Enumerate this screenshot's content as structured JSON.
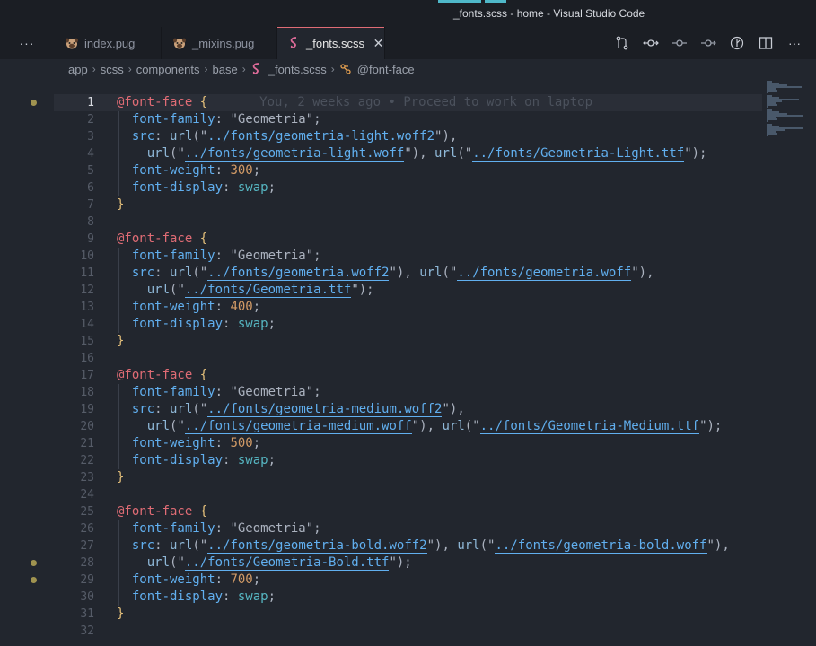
{
  "window": {
    "title": "_fonts.scss - home - Visual Studio Code"
  },
  "tabs": [
    {
      "label": "index.pug",
      "icon": "pug-icon",
      "active": false
    },
    {
      "label": "_mixins.pug",
      "icon": "pug-icon",
      "active": false
    },
    {
      "label": "_fonts.scss",
      "icon": "sass-icon",
      "active": true
    }
  ],
  "tab_more": "···",
  "tab_close": "✕",
  "actions": [
    {
      "name": "source-control-icon",
      "glyph": "⇅"
    },
    {
      "name": "git-compare-icon",
      "glyph": "↔"
    },
    {
      "name": "git-commit-icon",
      "glyph": "⊸"
    },
    {
      "name": "git-next-icon",
      "glyph": "→"
    },
    {
      "name": "git-graph-icon",
      "glyph": "⚲"
    },
    {
      "name": "split-editor-icon",
      "glyph": "◫"
    },
    {
      "name": "more-actions-icon",
      "glyph": "···"
    }
  ],
  "breadcrumb": [
    "app",
    "scss",
    "components",
    "base",
    "_fonts.scss",
    "@font-face"
  ],
  "blame": "You, 2 weeks ago • Proceed to work on laptop",
  "lines": [
    {
      "n": "1",
      "t": [
        [
          "at",
          "@font-face"
        ],
        [
          "pun",
          " "
        ],
        [
          "br",
          "{"
        ]
      ]
    },
    {
      "n": "2",
      "t": [
        [
          "pun",
          "  "
        ],
        [
          "prop",
          "font-family"
        ],
        [
          "pun",
          ": "
        ],
        [
          "strq",
          "\"Geometria\""
        ],
        [
          "pun",
          ";"
        ]
      ]
    },
    {
      "n": "3",
      "t": [
        [
          "pun",
          "  "
        ],
        [
          "prop",
          "src"
        ],
        [
          "pun",
          ": "
        ],
        [
          "fn",
          "url"
        ],
        [
          "pun",
          "(\""
        ],
        [
          "url",
          "../fonts/geometria-light.woff2"
        ],
        [
          "pun",
          "\"),"
        ]
      ]
    },
    {
      "n": "4",
      "t": [
        [
          "pun",
          "    "
        ],
        [
          "fn",
          "url"
        ],
        [
          "pun",
          "(\""
        ],
        [
          "url",
          "../fonts/geometria-light.woff"
        ],
        [
          "pun",
          "\"), "
        ],
        [
          "fn",
          "url"
        ],
        [
          "pun",
          "(\""
        ],
        [
          "url",
          "../fonts/Geometria-Light.ttf"
        ],
        [
          "pun",
          "\");"
        ]
      ]
    },
    {
      "n": "5",
      "t": [
        [
          "pun",
          "  "
        ],
        [
          "prop",
          "font-weight"
        ],
        [
          "pun",
          ": "
        ],
        [
          "num",
          "300"
        ],
        [
          "pun",
          ";"
        ]
      ]
    },
    {
      "n": "6",
      "t": [
        [
          "pun",
          "  "
        ],
        [
          "prop",
          "font-display"
        ],
        [
          "pun",
          ": "
        ],
        [
          "val",
          "swap"
        ],
        [
          "pun",
          ";"
        ]
      ]
    },
    {
      "n": "7",
      "t": [
        [
          "br",
          "}"
        ]
      ]
    },
    {
      "n": "8",
      "t": []
    },
    {
      "n": "9",
      "t": [
        [
          "at",
          "@font-face"
        ],
        [
          "pun",
          " "
        ],
        [
          "br",
          "{"
        ]
      ]
    },
    {
      "n": "10",
      "t": [
        [
          "pun",
          "  "
        ],
        [
          "prop",
          "font-family"
        ],
        [
          "pun",
          ": "
        ],
        [
          "strq",
          "\"Geometria\""
        ],
        [
          "pun",
          ";"
        ]
      ]
    },
    {
      "n": "11",
      "t": [
        [
          "pun",
          "  "
        ],
        [
          "prop",
          "src"
        ],
        [
          "pun",
          ": "
        ],
        [
          "fn",
          "url"
        ],
        [
          "pun",
          "(\""
        ],
        [
          "url",
          "../fonts/geometria.woff2"
        ],
        [
          "pun",
          "\"), "
        ],
        [
          "fn",
          "url"
        ],
        [
          "pun",
          "(\""
        ],
        [
          "url",
          "../fonts/geometria.woff"
        ],
        [
          "pun",
          "\"),"
        ]
      ]
    },
    {
      "n": "12",
      "t": [
        [
          "pun",
          "    "
        ],
        [
          "fn",
          "url"
        ],
        [
          "pun",
          "(\""
        ],
        [
          "url",
          "../fonts/Geometria.ttf"
        ],
        [
          "pun",
          "\");"
        ]
      ]
    },
    {
      "n": "13",
      "t": [
        [
          "pun",
          "  "
        ],
        [
          "prop",
          "font-weight"
        ],
        [
          "pun",
          ": "
        ],
        [
          "num",
          "400"
        ],
        [
          "pun",
          ";"
        ]
      ]
    },
    {
      "n": "14",
      "t": [
        [
          "pun",
          "  "
        ],
        [
          "prop",
          "font-display"
        ],
        [
          "pun",
          ": "
        ],
        [
          "val",
          "swap"
        ],
        [
          "pun",
          ";"
        ]
      ]
    },
    {
      "n": "15",
      "t": [
        [
          "br",
          "}"
        ]
      ]
    },
    {
      "n": "16",
      "t": []
    },
    {
      "n": "17",
      "t": [
        [
          "at",
          "@font-face"
        ],
        [
          "pun",
          " "
        ],
        [
          "br",
          "{"
        ]
      ]
    },
    {
      "n": "18",
      "t": [
        [
          "pun",
          "  "
        ],
        [
          "prop",
          "font-family"
        ],
        [
          "pun",
          ": "
        ],
        [
          "strq",
          "\"Geometria\""
        ],
        [
          "pun",
          ";"
        ]
      ]
    },
    {
      "n": "19",
      "t": [
        [
          "pun",
          "  "
        ],
        [
          "prop",
          "src"
        ],
        [
          "pun",
          ": "
        ],
        [
          "fn",
          "url"
        ],
        [
          "pun",
          "(\""
        ],
        [
          "url",
          "../fonts/geometria-medium.woff2"
        ],
        [
          "pun",
          "\"),"
        ]
      ]
    },
    {
      "n": "20",
      "t": [
        [
          "pun",
          "    "
        ],
        [
          "fn",
          "url"
        ],
        [
          "pun",
          "(\""
        ],
        [
          "url",
          "../fonts/geometria-medium.woff"
        ],
        [
          "pun",
          "\"), "
        ],
        [
          "fn",
          "url"
        ],
        [
          "pun",
          "(\""
        ],
        [
          "url",
          "../fonts/Geometria-Medium.ttf"
        ],
        [
          "pun",
          "\");"
        ]
      ]
    },
    {
      "n": "21",
      "t": [
        [
          "pun",
          "  "
        ],
        [
          "prop",
          "font-weight"
        ],
        [
          "pun",
          ": "
        ],
        [
          "num",
          "500"
        ],
        [
          "pun",
          ";"
        ]
      ]
    },
    {
      "n": "22",
      "t": [
        [
          "pun",
          "  "
        ],
        [
          "prop",
          "font-display"
        ],
        [
          "pun",
          ": "
        ],
        [
          "val",
          "swap"
        ],
        [
          "pun",
          ";"
        ]
      ]
    },
    {
      "n": "23",
      "t": [
        [
          "br",
          "}"
        ]
      ]
    },
    {
      "n": "24",
      "t": []
    },
    {
      "n": "25",
      "t": [
        [
          "at",
          "@font-face"
        ],
        [
          "pun",
          " "
        ],
        [
          "br",
          "{"
        ]
      ]
    },
    {
      "n": "26",
      "t": [
        [
          "pun",
          "  "
        ],
        [
          "prop",
          "font-family"
        ],
        [
          "pun",
          ": "
        ],
        [
          "strq",
          "\"Geometria\""
        ],
        [
          "pun",
          ";"
        ]
      ]
    },
    {
      "n": "27",
      "t": [
        [
          "pun",
          "  "
        ],
        [
          "prop",
          "src"
        ],
        [
          "pun",
          ": "
        ],
        [
          "fn",
          "url"
        ],
        [
          "pun",
          "(\""
        ],
        [
          "url",
          "../fonts/geometria-bold.woff2"
        ],
        [
          "pun",
          "\"), "
        ],
        [
          "fn",
          "url"
        ],
        [
          "pun",
          "(\""
        ],
        [
          "url",
          "../fonts/geometria-bold.woff"
        ],
        [
          "pun",
          "\"),"
        ]
      ]
    },
    {
      "n": "28",
      "t": [
        [
          "pun",
          "    "
        ],
        [
          "fn",
          "url"
        ],
        [
          "pun",
          "(\""
        ],
        [
          "url",
          "../fonts/Geometria-Bold.ttf"
        ],
        [
          "pun",
          "\");"
        ]
      ]
    },
    {
      "n": "29",
      "t": [
        [
          "pun",
          "  "
        ],
        [
          "prop",
          "font-weight"
        ],
        [
          "pun",
          ": "
        ],
        [
          "num",
          "700"
        ],
        [
          "pun",
          ";"
        ]
      ]
    },
    {
      "n": "30",
      "t": [
        [
          "pun",
          "  "
        ],
        [
          "prop",
          "font-display"
        ],
        [
          "pun",
          ": "
        ],
        [
          "val",
          "swap"
        ],
        [
          "pun",
          ";"
        ]
      ]
    },
    {
      "n": "31",
      "t": [
        [
          "br",
          "}"
        ]
      ]
    },
    {
      "n": "32",
      "t": []
    }
  ],
  "current_line": 1,
  "modified_lines": [
    1,
    28,
    29
  ],
  "colors": {
    "accent": "#e06c75",
    "url": "#61afef",
    "number": "#d19a66",
    "keyword": "#56b6c2"
  }
}
